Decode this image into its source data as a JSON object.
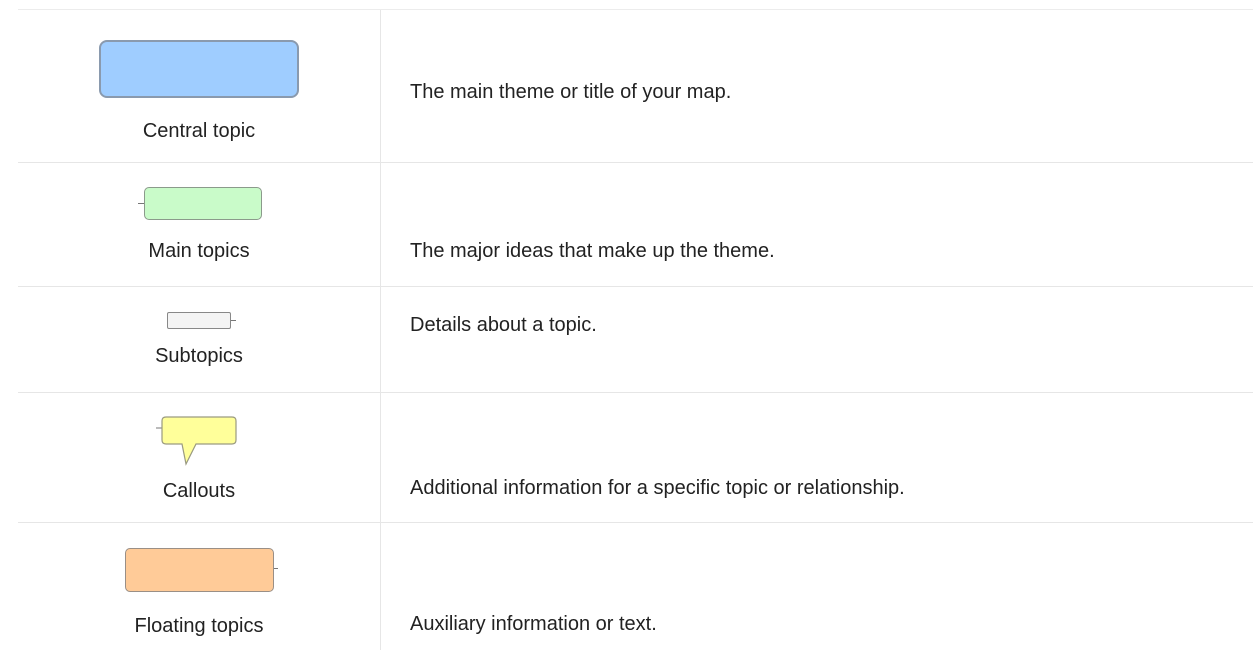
{
  "legend": {
    "rows": [
      {
        "label": "Central topic",
        "description": "The main theme or title of your map.",
        "shape_color": "#9fcdff",
        "icon": "central-topic-shape-icon"
      },
      {
        "label": "Main topics",
        "description": "The major ideas that make up the theme.",
        "shape_color": "#c9fbc9",
        "icon": "main-topic-shape-icon"
      },
      {
        "label": "Subtopics",
        "description": "Details about a topic.",
        "shape_color": "#f4f4f4",
        "icon": "subtopic-shape-icon"
      },
      {
        "label": "Callouts",
        "description": "Additional information for a specific topic or relationship.",
        "shape_color": "#ffff9a",
        "icon": "callout-shape-icon"
      },
      {
        "label": "Floating topics",
        "description": "Auxiliary information or text.",
        "shape_color": "#ffcb98",
        "icon": "floating-topic-shape-icon"
      }
    ]
  }
}
